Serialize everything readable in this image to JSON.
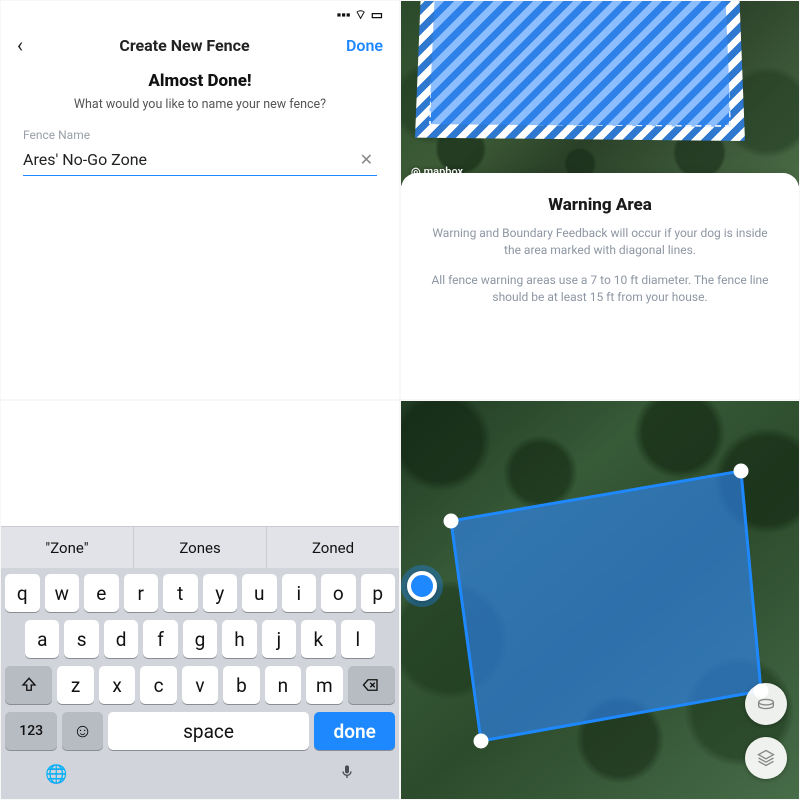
{
  "statusbar": {
    "time": ""
  },
  "nav": {
    "title": "Create New Fence",
    "done": "Done"
  },
  "almost": {
    "heading": "Almost Done!",
    "subtext": "What would you like to name your new fence?"
  },
  "field": {
    "label": "Fence Name",
    "value": "Ares' No-Go Zone",
    "clear": "✕"
  },
  "suggestions": [
    "\"Zone\"",
    "Zones",
    "Zoned"
  ],
  "keys": {
    "row1": [
      "q",
      "w",
      "e",
      "r",
      "t",
      "y",
      "u",
      "i",
      "o",
      "p"
    ],
    "row2": [
      "a",
      "s",
      "d",
      "f",
      "g",
      "h",
      "j",
      "k",
      "l"
    ],
    "row3": [
      "z",
      "x",
      "c",
      "v",
      "b",
      "n",
      "m"
    ],
    "numLabel": "123",
    "spaceLabel": "space",
    "doneLabel": "done"
  },
  "warning": {
    "title": "Warning Area",
    "p1": "Warning and Boundary Feedback will occur if your dog is inside the area marked with diagonal lines.",
    "p2": "All fence warning areas use a 7 to 10 ft diameter. The fence line should be at least 15 ft from your house."
  },
  "mapbox": "mapbox",
  "icons": {
    "back": "‹",
    "emoji": "☺",
    "globe": "🌐",
    "mic": "🎤"
  }
}
